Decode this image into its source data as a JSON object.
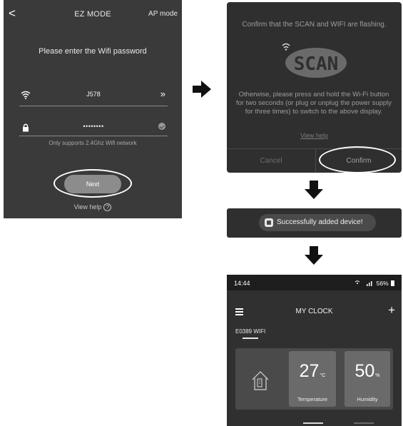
{
  "ez_mode": {
    "back_symbol": "<",
    "title": "EZ MODE",
    "ap_mode": "AP mode",
    "prompt": "Please enter the Wifi password",
    "ssid": "J578",
    "ssid_arrows": "»",
    "password_mask": "••••••••",
    "note": "Only supports 2.4Ghz Wifi network",
    "next_label": "Next",
    "help_label": "View help",
    "help_symbol": "?"
  },
  "confirm_dialog": {
    "title": "Confirm that the SCAN and WIFI are flashing.",
    "scan_display": "SCAN",
    "body": "Otherwise, please press and hold the Wi-Fi button for two seconds (or plug or unplug the power supply for three times) to switch to the above display.",
    "help_link": "View help",
    "cancel_label": "Cancel",
    "confirm_label": "Confirm"
  },
  "toast": {
    "message": "Successfully added device!"
  },
  "my_clock": {
    "status_time": "14:44",
    "status_right": "56%",
    "title": "MY CLOCK",
    "plus_symbol": "+",
    "device_name": "E0389 WIFI",
    "temperature_value": "27",
    "temperature_unit": "°C",
    "temperature_label": "Temperature",
    "humidity_value": "50",
    "humidity_unit": "%",
    "humidity_label": "Humidity"
  },
  "colors": {
    "panel_dark": "#3a3a3a",
    "dialog_dark": "#2f2f2f",
    "highlight": "#ffffff",
    "tile_gray": "#6a6a6a"
  }
}
